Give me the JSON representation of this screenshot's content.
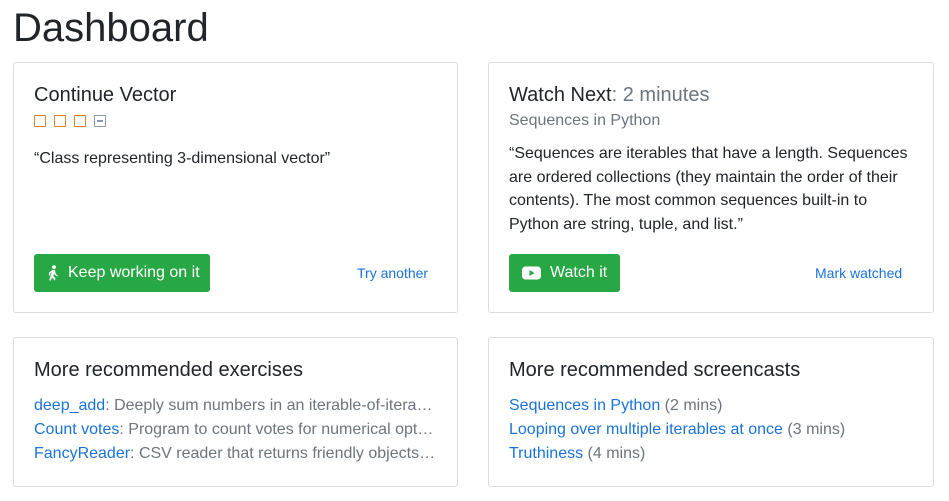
{
  "page": {
    "title": "Dashboard"
  },
  "continue_card": {
    "title": "Continue Vector",
    "progress": [
      "incomplete",
      "incomplete",
      "incomplete",
      "skipped"
    ],
    "quote": "“Class representing 3-dimensional vector”",
    "primary_button": "Keep working on it",
    "secondary_link": "Try another"
  },
  "watch_card": {
    "title": "Watch Next",
    "duration": ": 2 minutes",
    "subtitle": "Sequences in Python",
    "quote": "“Sequences are iterables that have a length. Sequences are ordered collections (they maintain the order of their contents). The most common sequences built-in to Python are string, tuple, and list.”",
    "primary_button": "Watch it",
    "secondary_link": "Mark watched"
  },
  "exercises_card": {
    "title": "More recommended exercises",
    "items": [
      {
        "name": "deep_add",
        "desc": ": Deeply sum numbers in an iterable-of-iterables"
      },
      {
        "name": "Count votes",
        "desc": ": Program to count votes for numerical options"
      },
      {
        "name": "FancyReader",
        "desc": ": CSV reader that returns friendly objects for each row"
      }
    ]
  },
  "screencasts_card": {
    "title": "More recommended screencasts",
    "items": [
      {
        "name": "Sequences in Python",
        "desc": " (2 mins)"
      },
      {
        "name": "Looping over multiple iterables at once",
        "desc": " (3 mins)"
      },
      {
        "name": "Truthiness",
        "desc": " (4 mins)"
      }
    ]
  },
  "colors": {
    "accent_green": "#28a745",
    "link_blue": "#1a73d9",
    "progress_orange": "#d9822b"
  },
  "icons": {
    "keep_working": "walking-person-icon",
    "watch": "youtube-play-icon"
  }
}
